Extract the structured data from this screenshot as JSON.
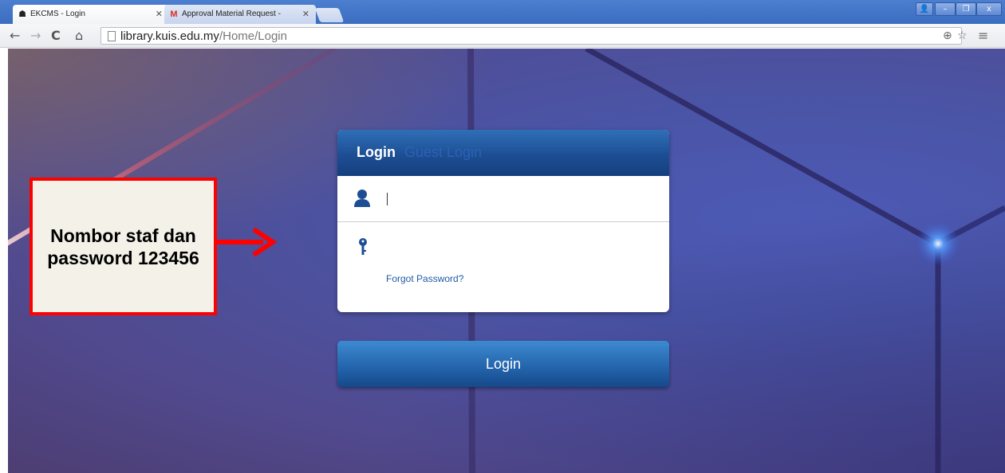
{
  "browser": {
    "tabs": [
      {
        "title": "EKCMS - Login",
        "favicon": "ekcms-favicon"
      },
      {
        "title": "Approval Material Request -",
        "favicon": "gmail-icon"
      }
    ],
    "url_host": "library.kuis.edu.my",
    "url_path": "/Home/Login"
  },
  "login": {
    "tab_login": "Login",
    "tab_guest": "Guest Login",
    "forgot_password": "Forgot Password?",
    "submit_label": "Login"
  },
  "annotation": {
    "text": "Nombor staf dan password 123456",
    "border_color": "#ff0000"
  },
  "colors": {
    "header_blue": "#1d4e94",
    "link_blue": "#1f5aa6",
    "tabbar_blue": "#3a6cc0"
  }
}
